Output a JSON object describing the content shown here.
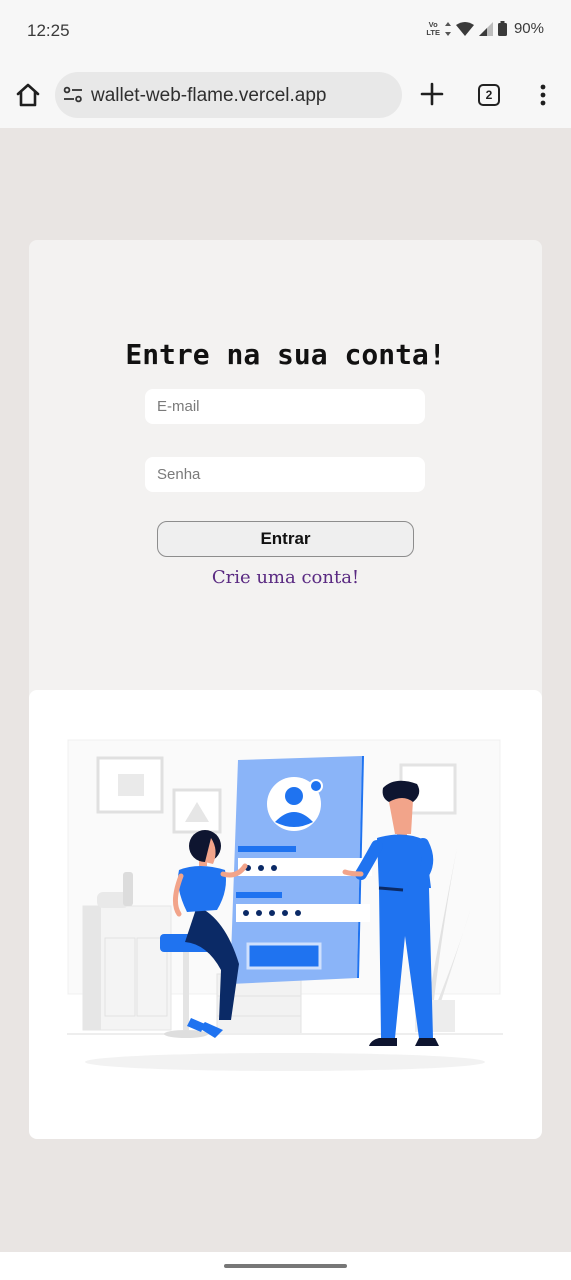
{
  "status_bar": {
    "time": "12:25",
    "volte_top": "Vo",
    "volte_bottom": "LTE",
    "battery": "90%",
    "icons": [
      "volte-icon",
      "data-arrows-icon",
      "wifi-icon",
      "signal-icon",
      "battery-icon"
    ]
  },
  "browser": {
    "url": "wallet-web-flame.vercel.app",
    "tab_count": "2",
    "icons": [
      "home-icon",
      "site-settings-icon",
      "new-tab-icon",
      "tabs-icon",
      "more-menu-icon"
    ]
  },
  "login": {
    "title": "Entre na sua conta!",
    "email_placeholder": "E-mail",
    "password_placeholder": "Senha",
    "submit_label": "Entrar",
    "signup_link": "Crie uma conta!"
  },
  "colors": {
    "page_background": "#e9e5e3",
    "card_background": "#f3f2f1",
    "link": "#5a2a82",
    "illustration_primary": "#1f73f0",
    "illustration_panel": "#8ab4f8",
    "illustration_navy": "#0b2a66"
  }
}
